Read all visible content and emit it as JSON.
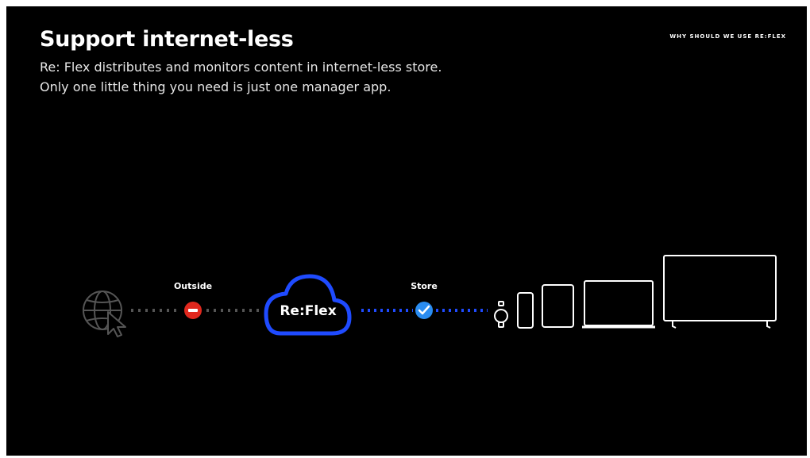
{
  "slide": {
    "title": "Support internet-less",
    "subtitle_line1": "Re: Flex distributes and monitors content in internet-less store.",
    "subtitle_line2": "Only one little thing you need is just one manager app.",
    "section_tag": "WHY SHOULD WE USE RE:FLEX"
  },
  "diagram": {
    "outside_label": "Outside",
    "store_label": "Store",
    "cloud_label": "Re:Flex",
    "outside_status": "blocked",
    "store_status": "connected",
    "devices": [
      "watch-icon",
      "phone-icon",
      "tablet-icon",
      "laptop-icon",
      "tv-icon"
    ],
    "colors": {
      "background": "#000000",
      "accent_blue": "#1f4bff",
      "blocked_red": "#e0281e",
      "check_blue": "#2a8cf0",
      "muted_gray": "#555555"
    }
  }
}
